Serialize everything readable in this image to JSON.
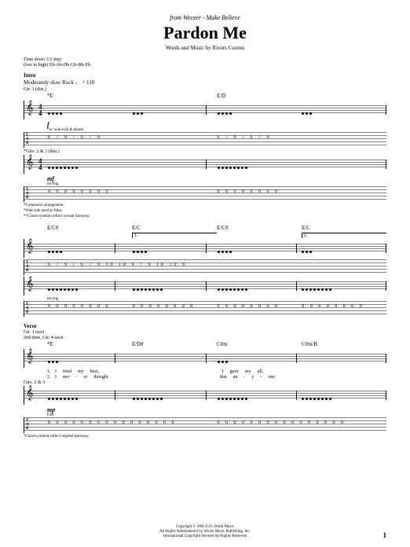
{
  "header": {
    "source_prefix": "from Weezer - ",
    "source_album": "Make Believe",
    "title": "Pardon Me",
    "credits": "Words and Music by Rivers Cuomo"
  },
  "tuning": {
    "line1": "Tune down 1/2 step:",
    "line2": "(low to high) Eb-Ab-Db-Gb-Bb-Eb"
  },
  "sections": {
    "intro": {
      "label": "Intro",
      "tempo": "Moderately slow Rock ♩ = 110",
      "gtr1_label": "Gtr. 1 (dist.)",
      "dynamic1": "f",
      "annotation1": "*w/ wah-wah & phaser",
      "gtr2_label": "*Gtrs. 2 & 3 (dist.)",
      "dynamic2": "mf",
      "annotation2": "let ring",
      "chords": [
        "*E",
        "E/D"
      ],
      "tab1": "6    7    9    7    6    7    9",
      "tab2": "0    0    0    0    0    0    0    0",
      "footnote1": "*Composite arrangement.",
      "footnote2": "*Wah-wah used as filter.",
      "footnote3": "**Chord symbols reflect overall harmony."
    },
    "system2": {
      "chords": [
        "E/C#",
        "E/C",
        "E/C#",
        "E/C"
      ],
      "endings": [
        "1.",
        "2."
      ],
      "tab1": "6   7   9   7   6   7   9      10  10  9  7   9      10  10  9",
      "annotation": "let ring",
      "tab2": "0   0   0   0   0   0   0   0"
    },
    "verse": {
      "label": "Verse",
      "gtr_note1": "Gtr. 1 tacet",
      "gtr_note2": "2nd time, Gtr. 4 tacet",
      "chords": [
        "*E",
        "E/D#",
        "C#m",
        "C#m/B"
      ],
      "lyrics1": [
        "I",
        "tried",
        "my",
        "best,",
        "",
        "I",
        "gave",
        "my",
        "all,"
      ],
      "lyrics2": [
        "I",
        "nev",
        "-",
        "er",
        "thought",
        "",
        "that",
        "an",
        "-",
        "y",
        "-",
        "one"
      ],
      "gtr23_label": "Gtrs. 2 & 3",
      "dynamic": "mp",
      "annotation_pm": "P.M.",
      "tab": "0 0 0 0 0 0 0 0   0 0 0 0 0 0 0 0",
      "footnote": "*Chord symbols reflect implied harmony."
    }
  },
  "footer": {
    "copyright": "Copyright © 2005 E.O. Smith Music",
    "admin": "All Rights Administered by Wixen Music Publishing, Inc.",
    "rights": "International Copyright Secured   All Rights Reserved"
  },
  "page_number": "1",
  "notation": {
    "clef": "𝄞",
    "time_top": "4",
    "time_bot": "4",
    "tab_T": "T",
    "tab_A": "A",
    "tab_B": "B"
  }
}
